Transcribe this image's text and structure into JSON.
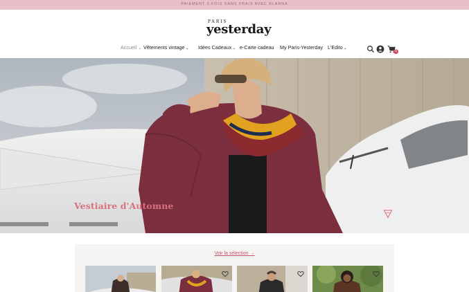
{
  "announcement": {
    "text": "PAIEMENT 3 FOIS SANS FRAIS AVEC KLARNA"
  },
  "logo": {
    "top_line": "PARIS",
    "main": "yesterday"
  },
  "nav": {
    "items": [
      {
        "label": "Accueil",
        "has_dropdown": false,
        "muted": true
      },
      {
        "label": "Vêtements vintage",
        "has_dropdown": true
      },
      {
        "label": "Idées Cadeaux",
        "has_dropdown": true
      },
      {
        "label": "e-Carte cadeau",
        "has_dropdown": false
      },
      {
        "label": "My Paris-Yesterday",
        "has_dropdown": false
      },
      {
        "label": "L'Edito",
        "has_dropdown": true
      }
    ],
    "dropdown_glyph": "⌄"
  },
  "header_icons": {
    "search": "search-icon",
    "account": "account-icon",
    "cart": "cart-icon",
    "cart_count": "0"
  },
  "hero": {
    "title": "Vestiaire d'Automne",
    "arrow": "down-triangle-arrow-icon"
  },
  "selection": {
    "link_label": "Voir la sélection →",
    "cards": 4
  },
  "colors": {
    "announce_bg": "#e9c0c8",
    "accent": "#d9707e",
    "link": "#c25068",
    "badge": "#d24a5f"
  }
}
